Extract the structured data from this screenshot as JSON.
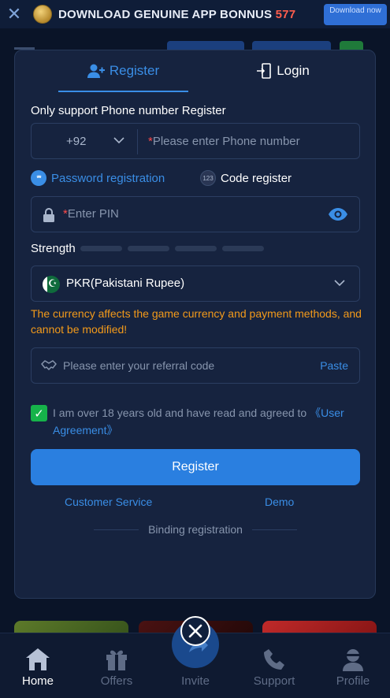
{
  "banner": {
    "text": "DOWNLOAD  GENUINE APP BONNUS ",
    "number": "577",
    "download_label": "Download now"
  },
  "modal": {
    "tabs": [
      {
        "label": "Register",
        "active": true
      },
      {
        "label": "Login",
        "active": false
      }
    ],
    "phone_section_label": "Only support Phone number Register",
    "country_code": "+92",
    "phone_placeholder": "Please enter Phone number",
    "required_mark": "*",
    "register_options": [
      {
        "label": "Password registration",
        "badge": "**",
        "selected": true
      },
      {
        "label": "Code register",
        "badge": "123",
        "selected": false
      }
    ],
    "pin_placeholder": "Enter PIN",
    "strength_label": "Strength",
    "strength_level": 0,
    "currency": "PKR(Pakistani Rupee)",
    "currency_warning": "The currency affects the game currency and payment methods, and cannot be modified!",
    "referral_placeholder": "Please enter your referral code",
    "paste_label": "Paste",
    "agreement_checked": true,
    "agreement_text": "I am over 18 years old and have read and agreed to ",
    "agreement_link": "《User Agreement》",
    "register_button": "Register",
    "customer_service": "Customer Service",
    "demo": "Demo",
    "binding_registration": "Binding registration"
  },
  "bottom_nav": [
    {
      "label": "Home",
      "icon": "home-icon",
      "active": true
    },
    {
      "label": "Offers",
      "icon": "gift-icon",
      "active": false
    },
    {
      "label": "Invite",
      "icon": "share-icon",
      "active": false
    },
    {
      "label": "Support",
      "icon": "phone-icon",
      "active": false
    },
    {
      "label": "Profile",
      "icon": "user-icon",
      "active": false
    }
  ],
  "colors": {
    "accent": "#3a8ee6",
    "warning": "#f39a1a",
    "required": "#ff4a4a",
    "checkbox": "#16b34a",
    "modal_bg": "#16233f"
  }
}
